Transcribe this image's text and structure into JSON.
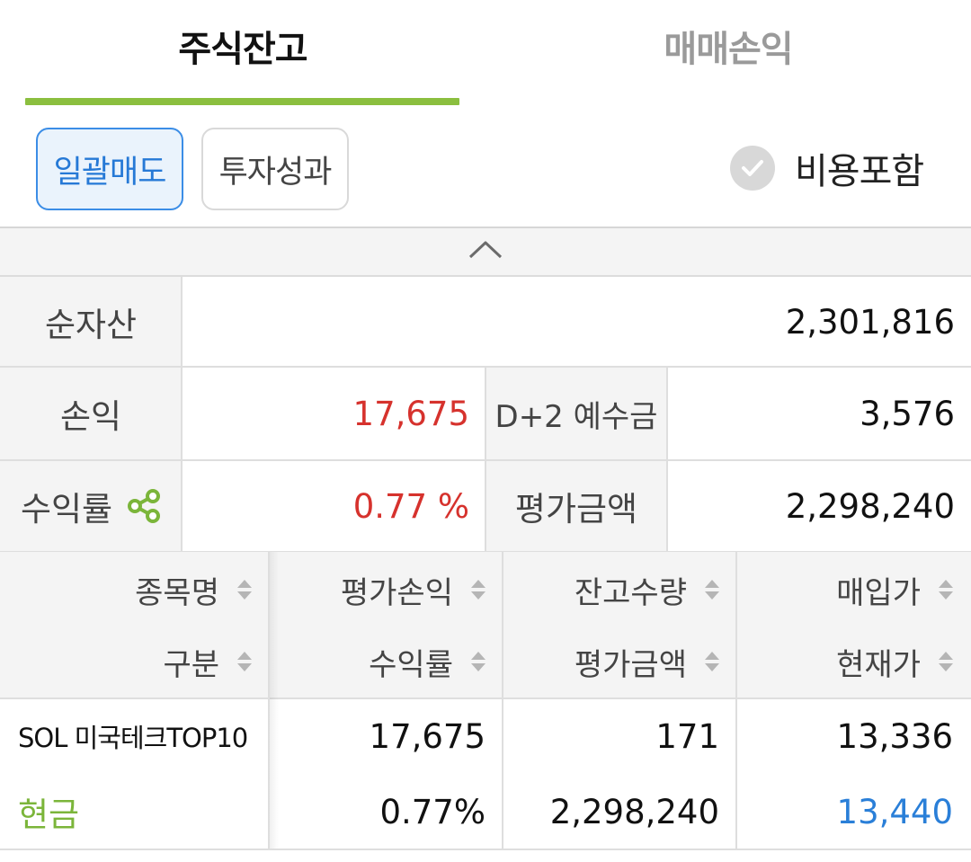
{
  "tabs": [
    {
      "label": "주식잔고",
      "active": true
    },
    {
      "label": "매매손익",
      "active": false
    }
  ],
  "toolbar": {
    "bulk_sell_label": "일괄매도",
    "performance_label": "투자성과",
    "include_fees_label": "비용포함",
    "include_fees_checked": false
  },
  "summary": {
    "net_assets_label": "순자산",
    "net_assets_value": "2,301,816",
    "pnl_label": "손익",
    "pnl_value": "17,675",
    "d2_deposit_label": "D+2 예수금",
    "d2_deposit_value": "3,576",
    "return_label": "수익률",
    "return_value": "0.77 %",
    "eval_amount_label": "평가금액",
    "eval_amount_value": "2,298,240"
  },
  "holdings": {
    "headers_row1": [
      "종목명",
      "평가손익",
      "잔고수량",
      "매입가"
    ],
    "headers_row2": [
      "구분",
      "수익률",
      "평가금액",
      "현재가"
    ],
    "rows": [
      {
        "name": "SOL 미국테크TOP10",
        "category": "현금",
        "eval_pnl": "17,675",
        "return_rate": "0.77%",
        "quantity": "171",
        "eval_amount": "2,298,240",
        "purchase_price": "13,336",
        "current_price": "13,440"
      }
    ]
  },
  "colors": {
    "accent_green": "#8bbf3f",
    "accent_blue": "#2679d6",
    "profit_red": "#d6322d",
    "price_blue": "#2a7fd8"
  }
}
